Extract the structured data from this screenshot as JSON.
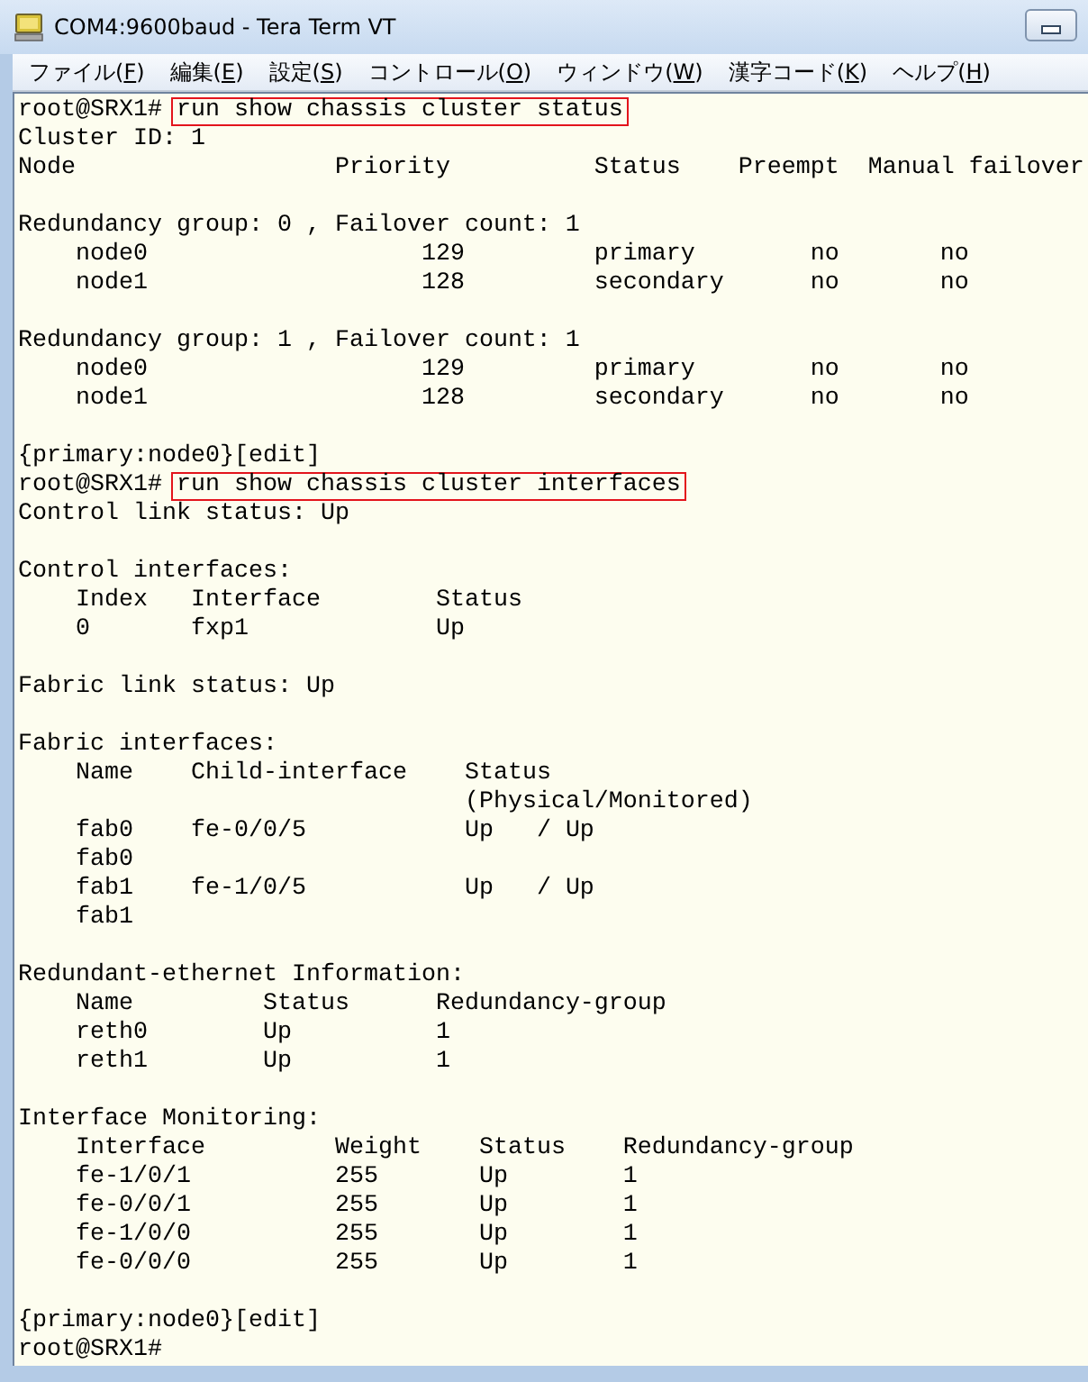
{
  "window": {
    "title": "COM4:9600baud - Tera Term VT"
  },
  "menu": [
    "ファイル(F)",
    "編集(E)",
    "設定(S)",
    "コントロール(O)",
    "ウィンドウ(W)",
    "漢字コード(K)",
    "ヘルプ(H)"
  ],
  "terminal": {
    "lines": [
      {
        "kind": "command",
        "prompt": "root@SRX1#",
        "command": "run show chassis cluster status",
        "highlighted": true
      },
      {
        "kind": "output",
        "text": "Cluster ID: 1"
      },
      {
        "kind": "output",
        "text": "Node                  Priority          Status    Preempt  Manual failover"
      },
      {
        "kind": "blank"
      },
      {
        "kind": "output",
        "text": "Redundancy group: 0 , Failover count: 1"
      },
      {
        "kind": "output",
        "text": "    node0                   129         primary        no       no"
      },
      {
        "kind": "output",
        "text": "    node1                   128         secondary      no       no"
      },
      {
        "kind": "blank"
      },
      {
        "kind": "output",
        "text": "Redundancy group: 1 , Failover count: 1"
      },
      {
        "kind": "output",
        "text": "    node0                   129         primary        no       no"
      },
      {
        "kind": "output",
        "text": "    node1                   128         secondary      no       no"
      },
      {
        "kind": "blank"
      },
      {
        "kind": "output",
        "text": "{primary:node0}[edit]"
      },
      {
        "kind": "command",
        "prompt": "root@SRX1#",
        "command": "run show chassis cluster interfaces",
        "highlighted": true
      },
      {
        "kind": "output",
        "text": "Control link status: Up"
      },
      {
        "kind": "blank"
      },
      {
        "kind": "output",
        "text": "Control interfaces:"
      },
      {
        "kind": "output",
        "text": "    Index   Interface        Status"
      },
      {
        "kind": "output",
        "text": "    0       fxp1             Up"
      },
      {
        "kind": "blank"
      },
      {
        "kind": "output",
        "text": "Fabric link status: Up"
      },
      {
        "kind": "blank"
      },
      {
        "kind": "output",
        "text": "Fabric interfaces:"
      },
      {
        "kind": "output",
        "text": "    Name    Child-interface    Status"
      },
      {
        "kind": "output",
        "text": "                               (Physical/Monitored)"
      },
      {
        "kind": "output",
        "text": "    fab0    fe-0/0/5           Up   / Up"
      },
      {
        "kind": "output",
        "text": "    fab0"
      },
      {
        "kind": "output",
        "text": "    fab1    fe-1/0/5           Up   / Up"
      },
      {
        "kind": "output",
        "text": "    fab1"
      },
      {
        "kind": "blank"
      },
      {
        "kind": "output",
        "text": "Redundant-ethernet Information:"
      },
      {
        "kind": "output",
        "text": "    Name         Status      Redundancy-group"
      },
      {
        "kind": "output",
        "text": "    reth0        Up          1"
      },
      {
        "kind": "output",
        "text": "    reth1        Up          1"
      },
      {
        "kind": "blank"
      },
      {
        "kind": "output",
        "text": "Interface Monitoring:"
      },
      {
        "kind": "output",
        "text": "    Interface         Weight    Status    Redundancy-group"
      },
      {
        "kind": "output",
        "text": "    fe-1/0/1          255       Up        1"
      },
      {
        "kind": "output",
        "text": "    fe-0/0/1          255       Up        1"
      },
      {
        "kind": "output",
        "text": "    fe-1/0/0          255       Up        1"
      },
      {
        "kind": "output",
        "text": "    fe-0/0/0          255       Up        1"
      },
      {
        "kind": "blank"
      },
      {
        "kind": "output",
        "text": "{primary:node0}[edit]"
      },
      {
        "kind": "prompt",
        "prompt": "root@SRX1#"
      }
    ]
  }
}
